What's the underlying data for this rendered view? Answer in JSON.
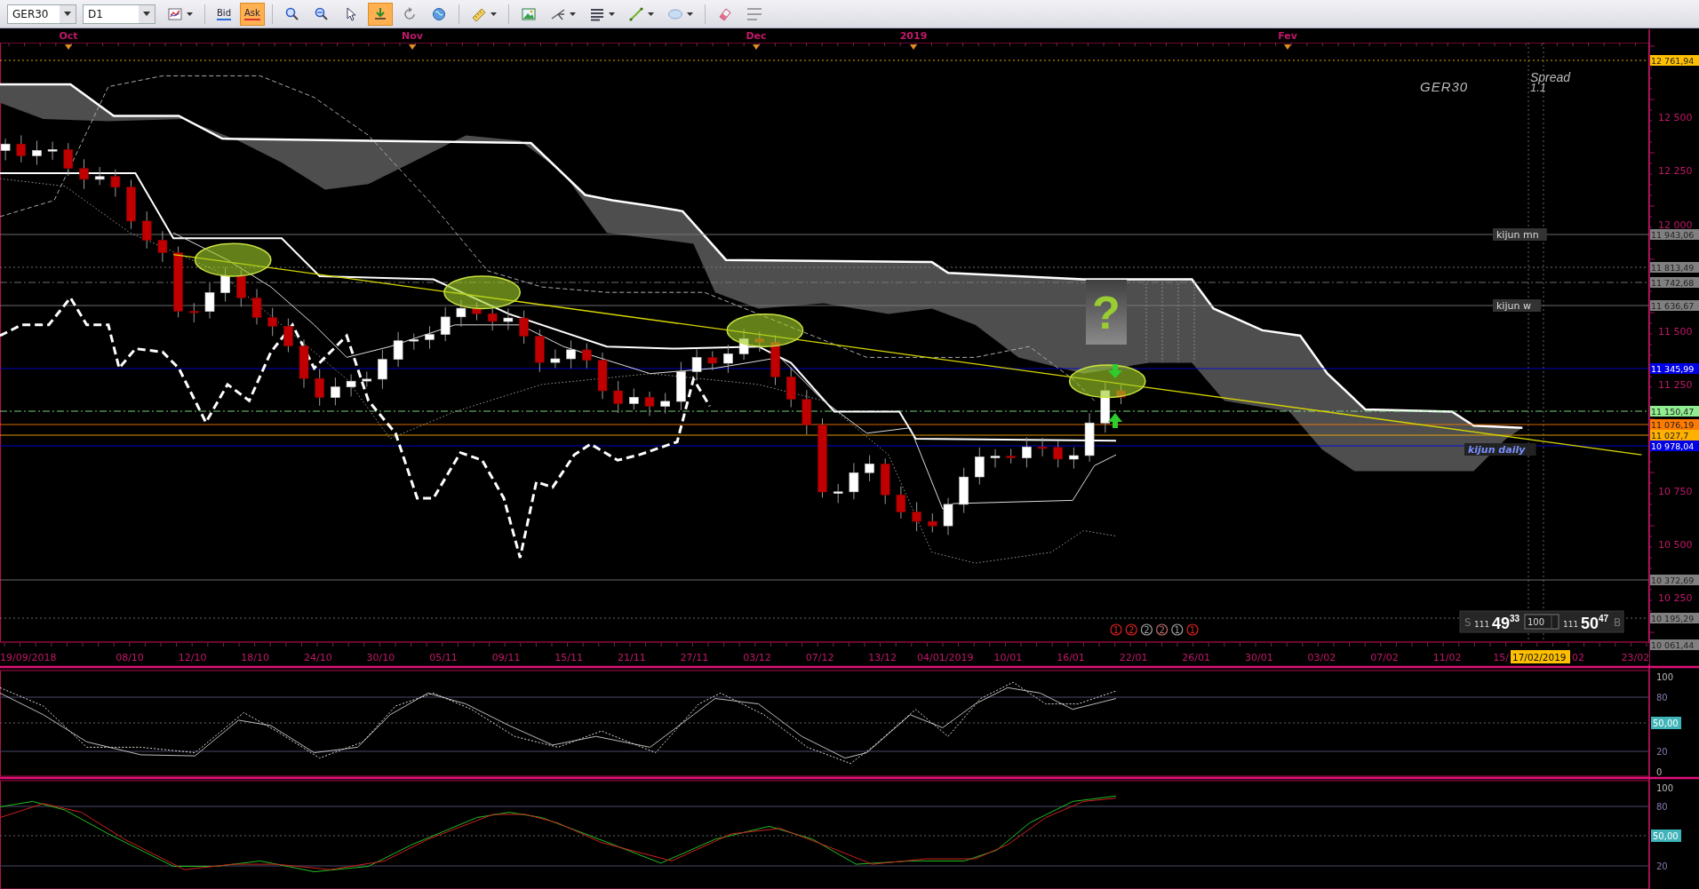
{
  "toolbar": {
    "symbol": {
      "value": "GER30"
    },
    "timeframe": {
      "value": "D1"
    },
    "tools": [
      {
        "kind": "icon",
        "selected": false,
        "dropdown": true
      },
      {
        "kind": "text",
        "label": "Bid",
        "selected": false,
        "dropdown": false
      },
      {
        "kind": "text",
        "label": "Ask",
        "selected": true,
        "dropdown": false
      },
      {
        "kind": "icon",
        "selected": false,
        "dropdown": false
      },
      {
        "kind": "icon",
        "selected": false,
        "dropdown": false
      },
      {
        "kind": "icon",
        "selected": false,
        "dropdown": false
      },
      {
        "kind": "icon",
        "selected": true,
        "dropdown": false
      },
      {
        "kind": "icon",
        "selected": false,
        "dropdown": false
      },
      {
        "kind": "icon",
        "selected": false,
        "dropdown": false
      },
      {
        "kind": "icon",
        "selected": false,
        "dropdown": true
      },
      {
        "kind": "icon",
        "selected": false,
        "dropdown": false
      },
      {
        "kind": "icon",
        "selected": false,
        "dropdown": true
      },
      {
        "kind": "icon",
        "selected": false,
        "dropdown": true
      },
      {
        "kind": "icon",
        "selected": false,
        "dropdown": true
      },
      {
        "kind": "icon",
        "selected": false,
        "dropdown": true
      },
      {
        "kind": "icon",
        "selected": false,
        "dropdown": false
      },
      {
        "kind": "icon",
        "selected": false,
        "dropdown": false
      }
    ]
  },
  "chart": {
    "symbol_label": "GER30",
    "spread_label": "Spread",
    "spread_value": "1.1",
    "months": [
      {
        "label": "Oct"
      },
      {
        "label": "Nov"
      },
      {
        "label": "Dec"
      },
      {
        "label": "2019"
      },
      {
        "label": "Fev"
      }
    ],
    "dates": [
      {
        "label": "19/09/2018",
        "kind": "start"
      },
      {
        "label": "08/10",
        "kind": "normal"
      },
      {
        "label": "12/10",
        "kind": "normal"
      },
      {
        "label": "18/10",
        "kind": "normal"
      },
      {
        "label": "24/10",
        "kind": "normal"
      },
      {
        "label": "30/10",
        "kind": "normal"
      },
      {
        "label": "05/11",
        "kind": "normal"
      },
      {
        "label": "09/11",
        "kind": "normal"
      },
      {
        "label": "15/11",
        "kind": "normal"
      },
      {
        "label": "21/11",
        "kind": "normal"
      },
      {
        "label": "27/11",
        "kind": "normal"
      },
      {
        "label": "03/12",
        "kind": "normal"
      },
      {
        "label": "07/12",
        "kind": "normal"
      },
      {
        "label": "13/12",
        "kind": "normal"
      },
      {
        "label": "04/01/2019",
        "kind": "normal"
      },
      {
        "label": "10/01",
        "kind": "normal"
      },
      {
        "label": "16/01",
        "kind": "normal"
      },
      {
        "label": "22/01",
        "kind": "normal"
      },
      {
        "label": "26/01",
        "kind": "normal"
      },
      {
        "label": "30/01",
        "kind": "normal"
      },
      {
        "label": "03/02",
        "kind": "normal"
      },
      {
        "label": "07/02",
        "kind": "normal"
      },
      {
        "label": "11/02",
        "kind": "normal"
      },
      {
        "label": "15/",
        "kind": "clipped_end"
      },
      {
        "label": "02",
        "kind": "clipped_start"
      },
      {
        "label": "23/02",
        "kind": "normal"
      }
    ],
    "cursor_date": "17/02/2019",
    "price_axis": [
      {
        "label": "12 500"
      },
      {
        "label": "12 250"
      },
      {
        "label": "12 000"
      },
      {
        "label": "11 500"
      },
      {
        "label": "11 250"
      },
      {
        "label": "10 750"
      },
      {
        "label": "10 500"
      },
      {
        "label": "10 250"
      }
    ],
    "price_tags": [
      {
        "label": "12 761,94",
        "color": "#ffc000"
      },
      {
        "label": "11 943,06",
        "color": "#808080"
      },
      {
        "label": "11 813,49",
        "color": "#808080"
      },
      {
        "label": "11 742,68",
        "color": "#808080"
      },
      {
        "label": "11 636,67",
        "color": "#808080"
      },
      {
        "label": "11 345,99",
        "color": "#0000e6"
      },
      {
        "label": "11 150,47",
        "color": "#90ee90"
      },
      {
        "label": "11 076,19",
        "color": "#ff7a00"
      },
      {
        "label": "11 027,7",
        "color": "#ffb000"
      },
      {
        "label": "10 978,04",
        "color": "#0000e6"
      },
      {
        "label": "10 372,69",
        "color": "#808080"
      },
      {
        "label": "10 195,29",
        "color": "#808080"
      },
      {
        "label": "10 061,44",
        "color": "#808080"
      }
    ],
    "level_labels": [
      {
        "label": "kijun mn"
      },
      {
        "label": "kijun w"
      },
      {
        "label": "kijun daily"
      }
    ],
    "question": "?",
    "markers": [
      {
        "label": "1",
        "color": "#e02020"
      },
      {
        "label": "2",
        "color": "#e02020"
      },
      {
        "label": "2",
        "color": "#a0a0a0"
      },
      {
        "label": "2",
        "color": "#c07070"
      },
      {
        "label": "1",
        "color": "#a0a0a0"
      },
      {
        "label": "1",
        "color": "#e02020"
      }
    ],
    "trade_panel": {
      "sell_side": "S",
      "sell_volume": "111",
      "sell_price": "49",
      "sell_fraction": "33",
      "quantity": "100",
      "buy_volume": "111",
      "buy_price": "50",
      "buy_fraction": "47",
      "buy_side": "B"
    }
  },
  "oscillators": [
    {
      "axis": [
        {
          "label": "100",
          "kind": "plain"
        },
        {
          "label": "80",
          "kind": "plain"
        },
        {
          "label": "50,00",
          "kind": "tag"
        },
        {
          "label": "20",
          "kind": "plain"
        },
        {
          "label": "0",
          "kind": "plain"
        }
      ]
    },
    {
      "axis": [
        {
          "label": "100",
          "kind": "plain"
        },
        {
          "label": "80",
          "kind": "plain"
        },
        {
          "label": "50,00",
          "kind": "tag"
        },
        {
          "label": "20",
          "kind": "plain"
        }
      ]
    }
  ]
}
